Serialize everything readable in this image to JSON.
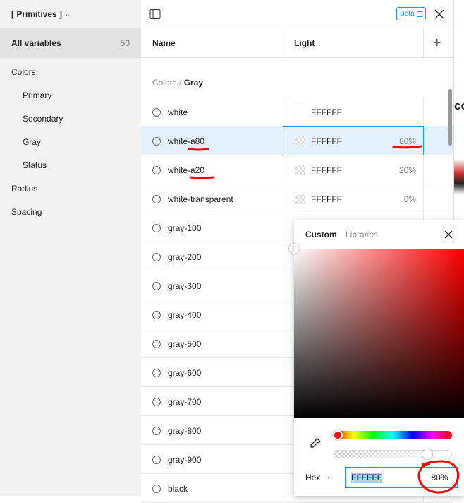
{
  "sidebar": {
    "collection": "[ Primitives ]",
    "all_label": "All variables",
    "all_count": "50",
    "groups": [
      {
        "label": "Colors"
      },
      {
        "label": "Primary"
      },
      {
        "label": "Secondary"
      },
      {
        "label": "Gray"
      },
      {
        "label": "Status"
      },
      {
        "label": "Radius"
      },
      {
        "label": "Spacing"
      }
    ]
  },
  "header": {
    "beta": "Beta"
  },
  "columns": {
    "name": "Name",
    "mode": "Light"
  },
  "breadcrumb": {
    "parent": "Colors",
    "sep": "/",
    "current": "Gray"
  },
  "rows": [
    {
      "name": "white",
      "hex": "FFFFFF",
      "pct": ""
    },
    {
      "name": "white-a80",
      "hex": "FFFFFF",
      "pct": "80%"
    },
    {
      "name": "white-a20",
      "hex": "FFFFFF",
      "pct": "20%"
    },
    {
      "name": "white-transparent",
      "hex": "FFFFFF",
      "pct": "0%"
    },
    {
      "name": "gray-100"
    },
    {
      "name": "gray-200"
    },
    {
      "name": "gray-300"
    },
    {
      "name": "gray-400"
    },
    {
      "name": "gray-500"
    },
    {
      "name": "gray-600"
    },
    {
      "name": "gray-700"
    },
    {
      "name": "gray-800"
    },
    {
      "name": "gray-900"
    },
    {
      "name": "black"
    }
  ],
  "picker": {
    "tab_custom": "Custom",
    "tab_libraries": "Libraries",
    "format": "Hex",
    "hex": "FFFFFF",
    "opacity": "80%",
    "alpha": 0.8
  },
  "canvas": {
    "text": "co"
  },
  "colors": {
    "accent": "#0d99ff",
    "annotation": "#ff0000"
  }
}
